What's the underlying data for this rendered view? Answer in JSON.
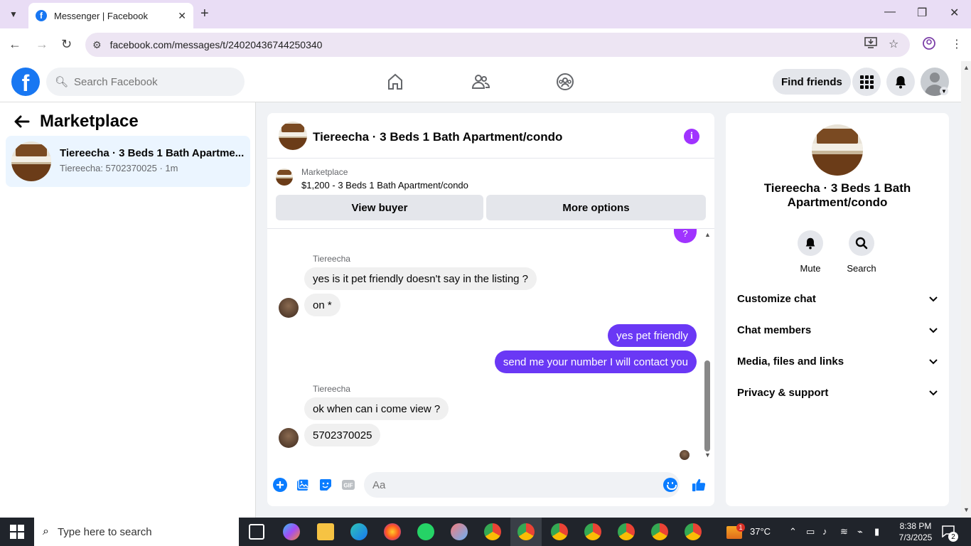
{
  "browser": {
    "tab_title": "Messenger | Facebook",
    "url": "facebook.com/messages/t/24020436744250340"
  },
  "fb_header": {
    "logo_letter": "f",
    "search_placeholder": "Search Facebook",
    "find_friends_label": "Find friends"
  },
  "left_panel": {
    "title": "Marketplace",
    "conversations": [
      {
        "name": "Tiereecha · 3 Beds 1 Bath Apartme...",
        "preview": "Tiereecha: 5702370025 · 1m"
      }
    ]
  },
  "chat": {
    "title": "Tiereecha · 3 Beds 1 Bath Apartment/condo",
    "marketplace_label": "Marketplace",
    "listing": "$1,200 - 3 Beds 1 Bath Apartment/condo",
    "view_buyer_label": "View buyer",
    "more_options_label": "More options",
    "partial_bubble": "?",
    "messages": [
      {
        "type": "sender",
        "text": "Tiereecha"
      },
      {
        "type": "in",
        "text": "yes is it pet friendly doesn't say in the listing ?"
      },
      {
        "type": "in",
        "text": "on *"
      },
      {
        "type": "out",
        "text": "yes pet friendly"
      },
      {
        "type": "out",
        "text": "send me your number I will contact you"
      },
      {
        "type": "sender",
        "text": "Tiereecha"
      },
      {
        "type": "in",
        "text": "ok when can i come view ?"
      },
      {
        "type": "in",
        "text": "5702370025"
      }
    ],
    "composer_placeholder": "Aa"
  },
  "right_panel": {
    "name": "Tiereecha · 3 Beds 1 Bath Apartment/condo",
    "mute_label": "Mute",
    "search_label": "Search",
    "sections": [
      "Customize chat",
      "Chat members",
      "Media, files and links",
      "Privacy & support"
    ]
  },
  "taskbar": {
    "search_text": "Type here to search",
    "weather_temp": "37°C",
    "weather_badge": "1",
    "time": "8:38 PM",
    "date": "7/3/2025",
    "notification_count": "2"
  },
  "colors": {
    "fb_blue": "#1877f2",
    "outgoing_bubble": "#6a38f5",
    "accent_purple": "#a033ff",
    "selected_conv_bg": "#ebf5ff"
  }
}
